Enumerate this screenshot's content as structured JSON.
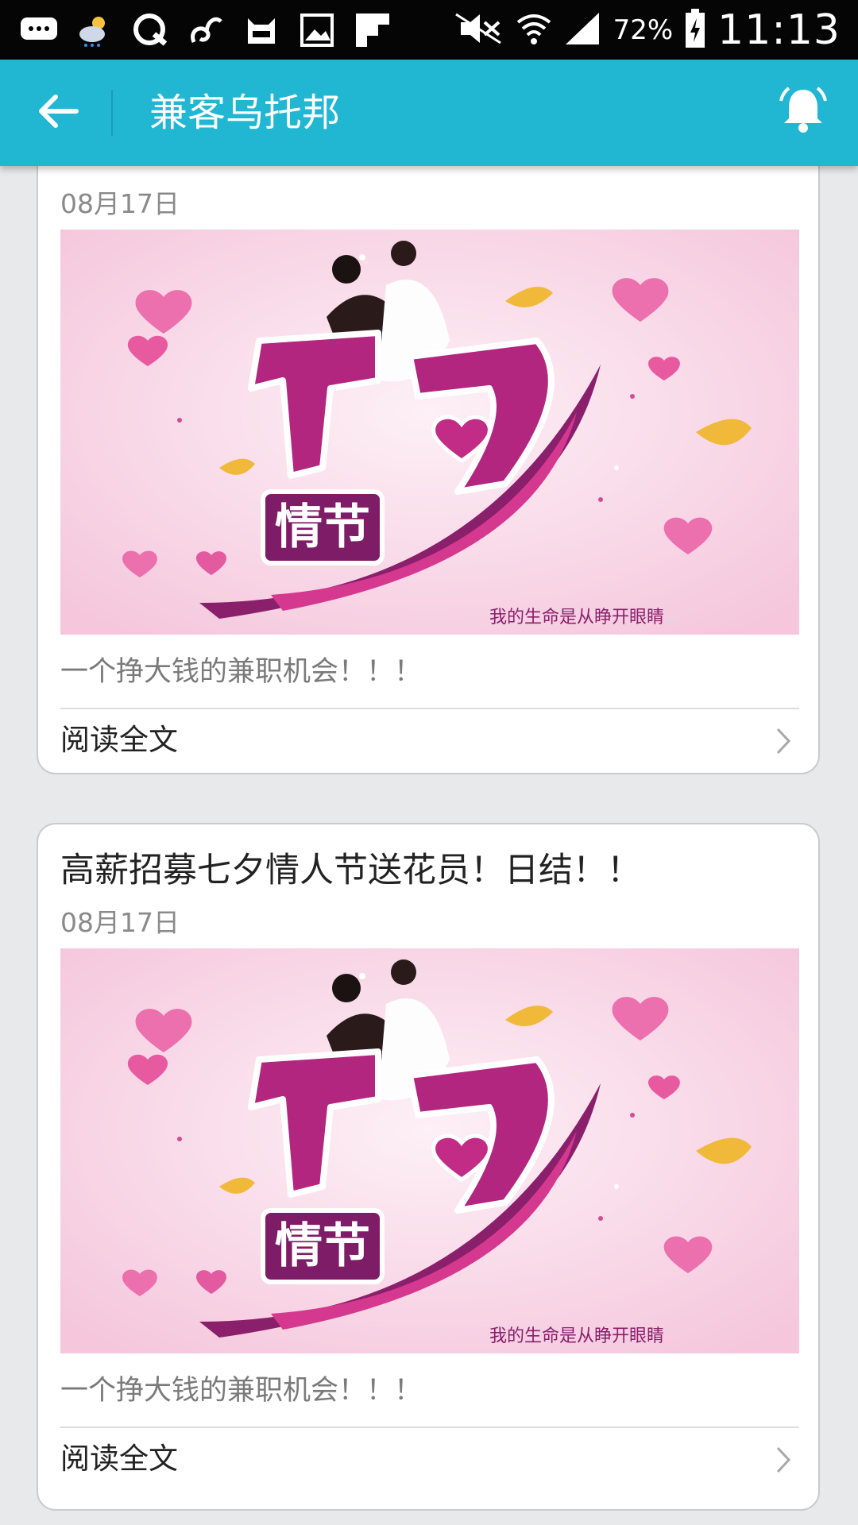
{
  "status_bar": {
    "battery_percent": "72%",
    "time": "11:13",
    "left_icons": [
      "message-icon",
      "weather-icon",
      "q-icon",
      "app-icon",
      "cat-icon",
      "image-icon",
      "flipboard-icon"
    ],
    "right_icons": [
      "mute-icon",
      "wifi-icon",
      "signal-icon",
      "battery-icon"
    ]
  },
  "app_bar": {
    "title": "兼客乌托邦",
    "back_icon": "arrow-left-icon",
    "notification_icon": "bell-icon",
    "background_color": "#21b6d2"
  },
  "articles": [
    {
      "title": "",
      "date": "08月17日",
      "image_caption": "我的生命是从睁开眼睛",
      "image_title_top": "七夕",
      "image_title_bottom": "情节",
      "description": "一个挣大钱的兼职机会！！！",
      "read_more": "阅读全文"
    },
    {
      "title": "高薪招募七夕情人节送花员！日结！！",
      "date": "08月17日",
      "image_caption": "我的生命是从睁开眼睛",
      "image_title_top": "七夕",
      "image_title_bottom": "情节",
      "description": "一个挣大钱的兼职机会！！！",
      "read_more": "阅读全文"
    }
  ]
}
